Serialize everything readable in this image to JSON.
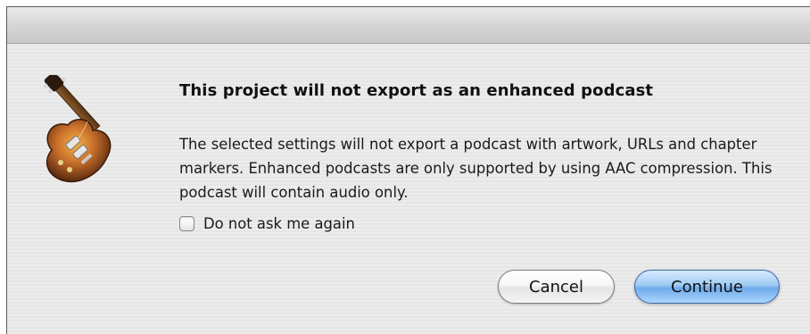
{
  "dialog": {
    "app_icon": "guitar-icon",
    "headline": "This project will not export as an enhanced podcast",
    "body": "The selected settings will not export a podcast with artwork, URLs and chapter markers. Enhanced podcasts are only supported by using AAC compression. This podcast will contain audio only.",
    "checkbox": {
      "label": "Do not ask me again",
      "checked": false
    },
    "buttons": {
      "cancel": "Cancel",
      "continue": "Continue"
    },
    "colors": {
      "default_button": "#8cc0f0",
      "titlebar": "#d4d4d4"
    }
  }
}
